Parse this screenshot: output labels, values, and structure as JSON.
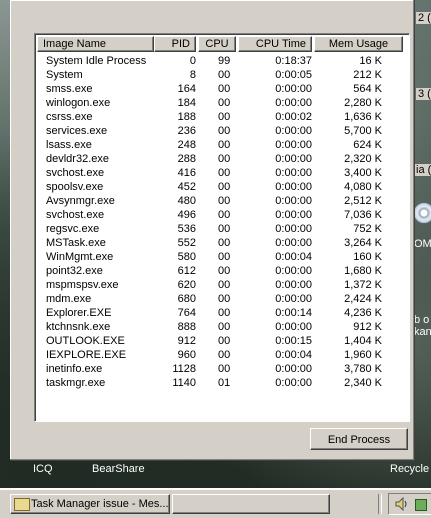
{
  "desktop": {
    "icon_labels": [
      "ICQ",
      "BearShare",
      "Recycle"
    ],
    "right_fragments": [
      "2 (",
      "3 (",
      "ia (",
      "OM",
      "b o",
      "kan"
    ]
  },
  "task_manager": {
    "columns": [
      "Image Name",
      "PID",
      "CPU",
      "CPU Time",
      "Mem Usage"
    ],
    "processes": [
      {
        "name": "System Idle Process",
        "pid": "0",
        "cpu": "99",
        "time": "0:18:37",
        "mem": "16 K"
      },
      {
        "name": "System",
        "pid": "8",
        "cpu": "00",
        "time": "0:00:05",
        "mem": "212 K"
      },
      {
        "name": "smss.exe",
        "pid": "164",
        "cpu": "00",
        "time": "0:00:00",
        "mem": "564 K"
      },
      {
        "name": "winlogon.exe",
        "pid": "184",
        "cpu": "00",
        "time": "0:00:00",
        "mem": "2,280 K"
      },
      {
        "name": "csrss.exe",
        "pid": "188",
        "cpu": "00",
        "time": "0:00:02",
        "mem": "1,636 K"
      },
      {
        "name": "services.exe",
        "pid": "236",
        "cpu": "00",
        "time": "0:00:00",
        "mem": "5,700 K"
      },
      {
        "name": "lsass.exe",
        "pid": "248",
        "cpu": "00",
        "time": "0:00:00",
        "mem": "624 K"
      },
      {
        "name": "devldr32.exe",
        "pid": "288",
        "cpu": "00",
        "time": "0:00:00",
        "mem": "2,320 K"
      },
      {
        "name": "svchost.exe",
        "pid": "416",
        "cpu": "00",
        "time": "0:00:00",
        "mem": "3,400 K"
      },
      {
        "name": "spoolsv.exe",
        "pid": "452",
        "cpu": "00",
        "time": "0:00:00",
        "mem": "4,080 K"
      },
      {
        "name": "Avsynmgr.exe",
        "pid": "480",
        "cpu": "00",
        "time": "0:00:00",
        "mem": "2,512 K"
      },
      {
        "name": "svchost.exe",
        "pid": "496",
        "cpu": "00",
        "time": "0:00:00",
        "mem": "7,036 K"
      },
      {
        "name": "regsvc.exe",
        "pid": "536",
        "cpu": "00",
        "time": "0:00:00",
        "mem": "752 K"
      },
      {
        "name": "MSTask.exe",
        "pid": "552",
        "cpu": "00",
        "time": "0:00:00",
        "mem": "3,264 K"
      },
      {
        "name": "WinMgmt.exe",
        "pid": "580",
        "cpu": "00",
        "time": "0:00:04",
        "mem": "160 K"
      },
      {
        "name": "point32.exe",
        "pid": "612",
        "cpu": "00",
        "time": "0:00:00",
        "mem": "1,680 K"
      },
      {
        "name": "mspmspsv.exe",
        "pid": "620",
        "cpu": "00",
        "time": "0:00:00",
        "mem": "1,372 K"
      },
      {
        "name": "mdm.exe",
        "pid": "680",
        "cpu": "00",
        "time": "0:00:00",
        "mem": "2,424 K"
      },
      {
        "name": "Explorer.EXE",
        "pid": "764",
        "cpu": "00",
        "time": "0:00:14",
        "mem": "4,236 K"
      },
      {
        "name": "ktchnsnk.exe",
        "pid": "888",
        "cpu": "00",
        "time": "0:00:00",
        "mem": "912 K"
      },
      {
        "name": "OUTLOOK.EXE",
        "pid": "912",
        "cpu": "00",
        "time": "0:00:15",
        "mem": "1,404 K"
      },
      {
        "name": "IEXPLORE.EXE",
        "pid": "960",
        "cpu": "00",
        "time": "0:00:04",
        "mem": "1,960 K"
      },
      {
        "name": "inetinfo.exe",
        "pid": "1128",
        "cpu": "00",
        "time": "0:00:00",
        "mem": "3,780 K"
      },
      {
        "name": "taskmgr.exe",
        "pid": "1140",
        "cpu": "01",
        "time": "0:00:00",
        "mem": "2,340 K"
      }
    ],
    "end_process_label": "End Process"
  },
  "taskbar": {
    "task_button_label": "Task Manager issue - Mes..."
  }
}
